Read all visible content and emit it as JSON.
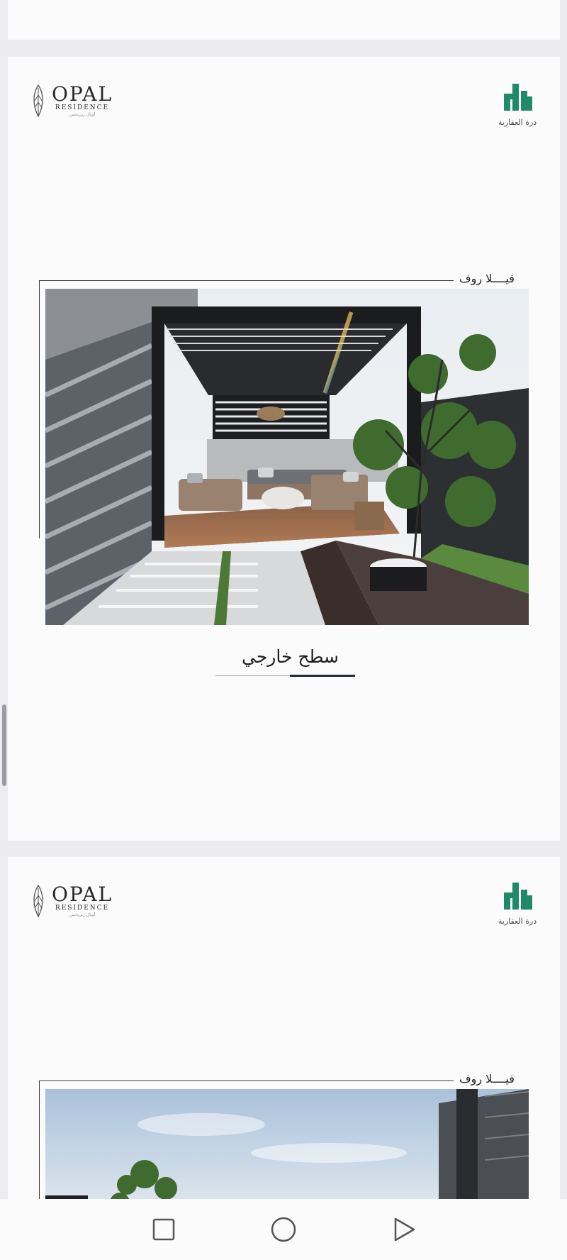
{
  "brand": {
    "opal_name": "OPAL",
    "opal_sub": "RESIDENCE",
    "opal_tagline": "أوبال ريزيدنس",
    "developer_name": "درة العقارية"
  },
  "pages": [
    {
      "villa_label": "فيــــلا روف",
      "caption": "سطح خارجي"
    },
    {
      "villa_label": "فيــــلا روف"
    }
  ],
  "navbar": {
    "buttons": [
      "square-icon",
      "circle-icon",
      "triangle-icon"
    ]
  },
  "colors": {
    "developer_green": "#1f8a68",
    "frame_line": "#3a3a3a",
    "accent_underline": "#1e2a3a"
  }
}
